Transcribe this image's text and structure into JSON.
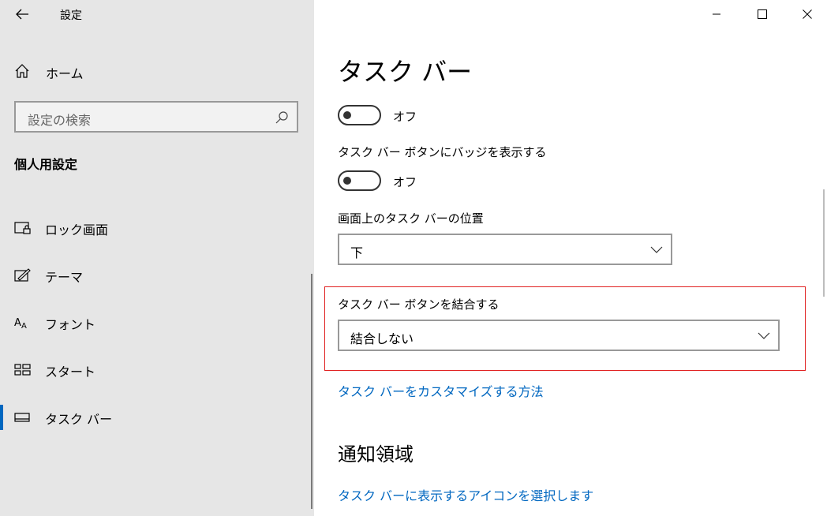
{
  "window": {
    "title": "設定"
  },
  "sidebar": {
    "home_label": "ホーム",
    "search_placeholder": "設定の検索",
    "section_title": "個人用設定",
    "items": [
      {
        "label": "ロック画面",
        "icon": "lock-screen-icon"
      },
      {
        "label": "テーマ",
        "icon": "theme-icon"
      },
      {
        "label": "フォント",
        "icon": "font-icon"
      },
      {
        "label": "スタート",
        "icon": "start-icon"
      },
      {
        "label": "タスク バー",
        "icon": "taskbar-icon",
        "selected": true
      }
    ]
  },
  "main": {
    "title": "タスク バー",
    "toggle1": {
      "state_text": "オフ",
      "on": false
    },
    "badge_setting": {
      "label": "タスク バー ボタンにバッジを表示する",
      "state_text": "オフ",
      "on": false
    },
    "position_setting": {
      "label": "画面上のタスク バーの位置",
      "value": "下"
    },
    "combine_setting": {
      "label": "タスク バー ボタンを結合する",
      "value": "結合しない"
    },
    "customize_link": "タスク バーをカスタマイズする方法",
    "notification_area_title": "通知領域",
    "select_icons_link": "タスク バーに表示するアイコンを選択します"
  },
  "colors": {
    "accent": "#0067c0",
    "sidebar_bg": "#e6e6e6",
    "highlight": "#e02020"
  }
}
